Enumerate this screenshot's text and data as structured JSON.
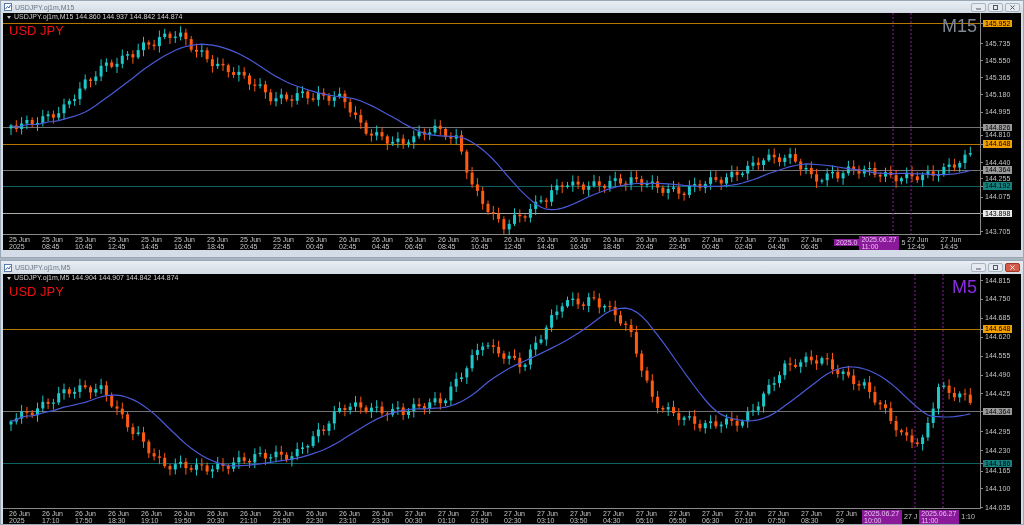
{
  "windows": [
    {
      "title": "USDJPY.oj1m,M15",
      "active": false,
      "chart_header": "USDJPY.oj1m,M15  144.860 144.937 144.842 144.874",
      "symbol": "USD JPY",
      "timeframe": {
        "text": "M15",
        "color": "#7f8893"
      },
      "price_axis": [
        {
          "text": "145.952",
          "kind": "marker",
          "color": "#f0a000"
        },
        {
          "text": "145.735",
          "kind": "tick"
        },
        {
          "text": "145.550",
          "kind": "tick"
        },
        {
          "text": "145.365",
          "kind": "tick"
        },
        {
          "text": "145.180",
          "kind": "tick"
        },
        {
          "text": "144.995",
          "kind": "tick"
        },
        {
          "text": "144.826",
          "kind": "marker",
          "color": "#9a9a9a"
        },
        {
          "text": "144.810",
          "kind": "tick"
        },
        {
          "text": "144.648",
          "kind": "marker",
          "color": "#f0a000"
        },
        {
          "text": "144.440",
          "kind": "tick"
        },
        {
          "text": "144.364",
          "kind": "marker",
          "color": "#9a9a9a"
        },
        {
          "text": "144.255",
          "kind": "tick"
        },
        {
          "text": "144.192",
          "kind": "marker",
          "color": "#13827f"
        },
        {
          "text": "144.075",
          "kind": "tick"
        },
        {
          "text": "143.898",
          "kind": "marker",
          "color": "#e8e8e8"
        },
        {
          "text": "143.705",
          "kind": "tick"
        }
      ],
      "time_axis": [
        {
          "text": "25 Jun 2025",
          "kind": "tick"
        },
        {
          "text": "25 Jun 08:45",
          "kind": "tick"
        },
        {
          "text": "25 Jun 10:45",
          "kind": "tick"
        },
        {
          "text": "25 Jun 12:45",
          "kind": "tick"
        },
        {
          "text": "25 Jun 14:45",
          "kind": "tick"
        },
        {
          "text": "25 Jun 16:45",
          "kind": "tick"
        },
        {
          "text": "25 Jun 18:45",
          "kind": "tick"
        },
        {
          "text": "25 Jun 20:45",
          "kind": "tick"
        },
        {
          "text": "25 Jun 22:45",
          "kind": "tick"
        },
        {
          "text": "26 Jun 00:45",
          "kind": "tick"
        },
        {
          "text": "26 Jun 02:45",
          "kind": "tick"
        },
        {
          "text": "26 Jun 04:45",
          "kind": "tick"
        },
        {
          "text": "26 Jun 06:45",
          "kind": "tick"
        },
        {
          "text": "26 Jun 08:45",
          "kind": "tick"
        },
        {
          "text": "26 Jun 10:45",
          "kind": "tick"
        },
        {
          "text": "26 Jun 12:45",
          "kind": "tick"
        },
        {
          "text": "26 Jun 14:45",
          "kind": "tick"
        },
        {
          "text": "26 Jun 16:45",
          "kind": "tick"
        },
        {
          "text": "26 Jun 18:45",
          "kind": "tick"
        },
        {
          "text": "26 Jun 20:45",
          "kind": "tick"
        },
        {
          "text": "26 Jun 22:45",
          "kind": "tick"
        },
        {
          "text": "27 Jun 00:45",
          "kind": "tick"
        },
        {
          "text": "27 Jun 02:45",
          "kind": "tick"
        },
        {
          "text": "27 Jun 04:45",
          "kind": "tick"
        },
        {
          "text": "27 Jun 06:45",
          "kind": "tick"
        },
        {
          "text": "2025.0",
          "kind": "highlight"
        },
        {
          "text": "2025.06.27 11:00",
          "kind": "highlight"
        },
        {
          "text": "5",
          "kind": "partial"
        },
        {
          "text": "27 Jun 12:45",
          "kind": "tick"
        },
        {
          "text": "27 Jun 14:45",
          "kind": "tick"
        }
      ]
    },
    {
      "title": "USDJPY.oj1m,M5",
      "active": true,
      "chart_header": "USDJPY.oj1m,M5  144.904 144.907 144.842 144.874",
      "symbol": "USD JPY",
      "timeframe": {
        "text": "M5",
        "color": "#8a2be2"
      },
      "price_axis": [
        {
          "text": "144.815",
          "kind": "tick"
        },
        {
          "text": "144.750",
          "kind": "tick"
        },
        {
          "text": "144.685",
          "kind": "tick"
        },
        {
          "text": "144.648",
          "kind": "marker",
          "color": "#f0a000"
        },
        {
          "text": "144.620",
          "kind": "tick"
        },
        {
          "text": "144.555",
          "kind": "tick"
        },
        {
          "text": "144.490",
          "kind": "tick"
        },
        {
          "text": "144.425",
          "kind": "tick"
        },
        {
          "text": "144.364",
          "kind": "marker",
          "color": "#9a9a9a"
        },
        {
          "text": "144.295",
          "kind": "tick"
        },
        {
          "text": "144.230",
          "kind": "tick"
        },
        {
          "text": "144.186",
          "kind": "marker",
          "color": "#13827f"
        },
        {
          "text": "144.165",
          "kind": "tick"
        },
        {
          "text": "144.100",
          "kind": "tick"
        },
        {
          "text": "144.035",
          "kind": "tick"
        }
      ],
      "time_axis": [
        {
          "text": "26 Jun 2025",
          "kind": "tick"
        },
        {
          "text": "26 Jun 17:10",
          "kind": "tick"
        },
        {
          "text": "26 Jun 17:50",
          "kind": "tick"
        },
        {
          "text": "26 Jun 18:30",
          "kind": "tick"
        },
        {
          "text": "26 Jun 19:10",
          "kind": "tick"
        },
        {
          "text": "26 Jun 19:50",
          "kind": "tick"
        },
        {
          "text": "26 Jun 20:30",
          "kind": "tick"
        },
        {
          "text": "26 Jun 21:10",
          "kind": "tick"
        },
        {
          "text": "26 Jun 21:50",
          "kind": "tick"
        },
        {
          "text": "26 Jun 22:30",
          "kind": "tick"
        },
        {
          "text": "26 Jun 23:10",
          "kind": "tick"
        },
        {
          "text": "26 Jun 23:50",
          "kind": "tick"
        },
        {
          "text": "27 Jun 00:30",
          "kind": "tick"
        },
        {
          "text": "27 Jun 01:10",
          "kind": "tick"
        },
        {
          "text": "27 Jun 01:50",
          "kind": "tick"
        },
        {
          "text": "27 Jun 02:30",
          "kind": "tick"
        },
        {
          "text": "27 Jun 03:10",
          "kind": "tick"
        },
        {
          "text": "27 Jun 03:50",
          "kind": "tick"
        },
        {
          "text": "27 Jun 04:30",
          "kind": "tick"
        },
        {
          "text": "27 Jun 05:10",
          "kind": "tick"
        },
        {
          "text": "27 Jun 05:50",
          "kind": "tick"
        },
        {
          "text": "27 Jun 06:30",
          "kind": "tick"
        },
        {
          "text": "27 Jun 07:10",
          "kind": "tick"
        },
        {
          "text": "27 Jun 07:50",
          "kind": "tick"
        },
        {
          "text": "27 Jun 08:30",
          "kind": "tick"
        },
        {
          "text": "27 Jun 09",
          "kind": "partial"
        },
        {
          "text": "2025.06.27 10:00",
          "kind": "highlight"
        },
        {
          "text": "27 J",
          "kind": "partial"
        },
        {
          "text": "2025.06.27 11:00",
          "kind": "highlight"
        },
        {
          "text": "1:10",
          "kind": "partial"
        }
      ]
    }
  ]
}
